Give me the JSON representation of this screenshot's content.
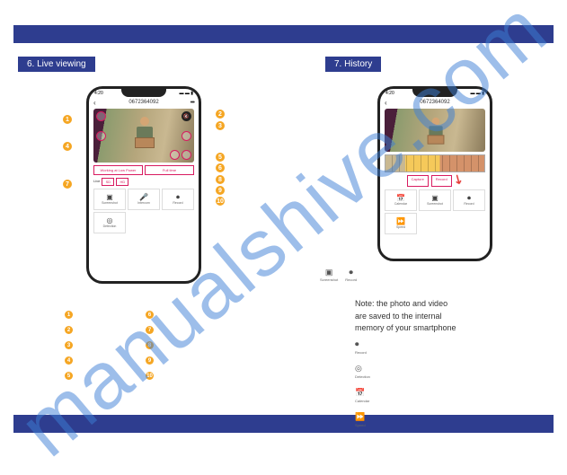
{
  "watermark": "manualshive.com",
  "section1_title": "6. Live viewing",
  "section2_title": "7. History",
  "phone": {
    "time": "4:20",
    "device_id": "0672364092",
    "mode_low_power": "Working at Low Power",
    "mode_full": "Full time",
    "quality_label": "Live",
    "quality_sd": "SD",
    "quality_hd": "HD",
    "func_screenshot": "Screenshot",
    "func_intercom": "Intercom",
    "func_record": "Record",
    "func_detection": "Detection"
  },
  "history": {
    "device_id": "0672364092",
    "btn_capture": "Capture",
    "btn_record": "Record",
    "func_calendar": "Calendar",
    "func_screenshot": "Screenshot",
    "func_record": "Record",
    "func_speed": "Speed"
  },
  "callouts_left": [
    "1",
    "4",
    "7"
  ],
  "callouts_right": [
    "2",
    "3",
    "5",
    "6",
    "8",
    "9",
    "10"
  ],
  "legend_left": [
    "1",
    "2",
    "3",
    "4",
    "5"
  ],
  "legend_right": [
    "6",
    "7",
    "8",
    "9",
    "10"
  ],
  "small_icon_1": "Screenshot",
  "small_icon_2": "Record",
  "note_line1": "Note: the photo and video",
  "note_line2": "are saved to the internal",
  "note_line3": "memory of your smartphone",
  "icon_col": [
    "Record",
    "Detection",
    "Calendar",
    "Speed"
  ]
}
